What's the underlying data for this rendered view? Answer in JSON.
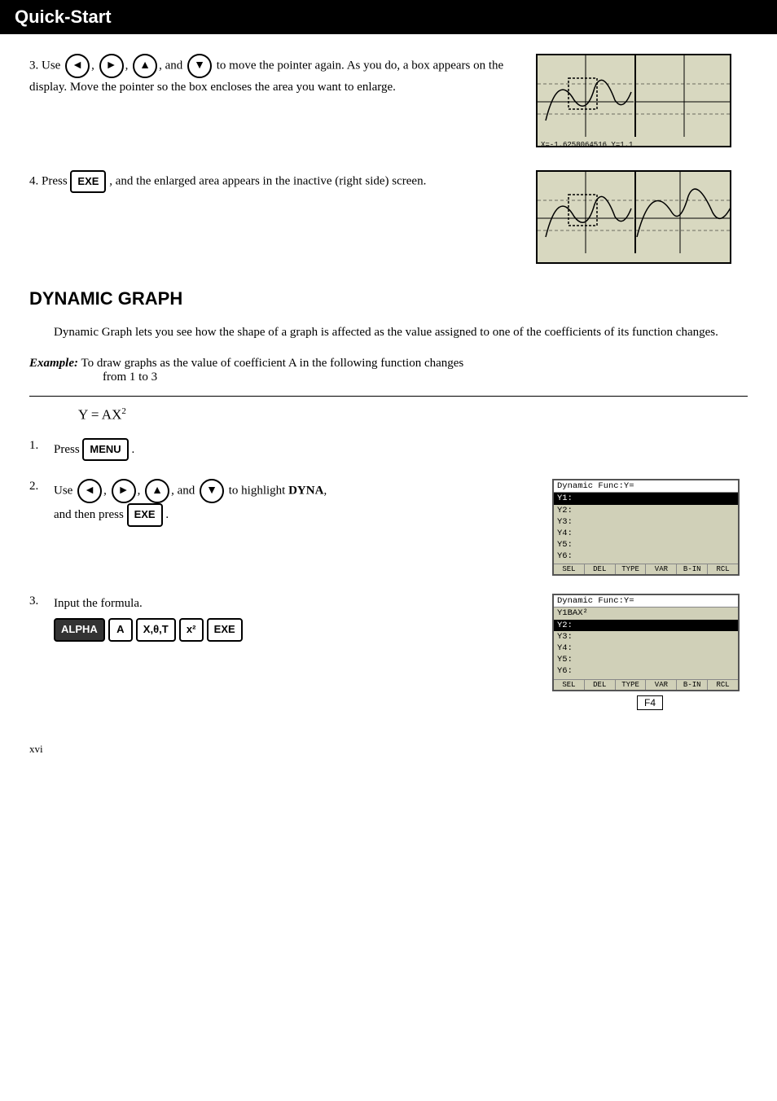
{
  "header": {
    "title": "Quick-Start"
  },
  "step3": {
    "number": "3.",
    "text1": "Use",
    "arrows": [
      "◄",
      "►",
      "▲",
      "▼"
    ],
    "and": "and",
    "text2": "to move the pointer again. As you do, a box appears on the display. Move the pointer so the box encloses the area you want to enlarge.",
    "screen_status": "X=-1.6258064516 Y=1.1"
  },
  "step4": {
    "number": "4.",
    "text1": "Press",
    "key": "EXE",
    "text2": ", and the enlarged area appears in the inactive (right side) screen."
  },
  "dynamic_graph": {
    "title": "DYNAMIC GRAPH",
    "intro": "Dynamic Graph lets you see how the shape of a graph is affected as the value assigned to one of the coefficients of its function changes.",
    "example_label": "Example:",
    "example_text": " To draw graphs as the value of coefficient A in the following  function changes",
    "example_indent": "from 1 to 3",
    "formula": "Y = AX²"
  },
  "dg_step1": {
    "number": "1.",
    "text1": "Press",
    "key": "MENU",
    "text2": "."
  },
  "dg_step2": {
    "number": "2.",
    "text1": "Use",
    "and": "and",
    "text2": "to highlight",
    "highlight": "DYNA",
    "text3": ",",
    "text4": "and then press",
    "key2": "EXE",
    "text5": ".",
    "screen": {
      "title": "Dynamic Func:Y=",
      "rows": [
        "Y1:",
        "Y2:",
        "Y3:",
        "Y4:",
        "Y5:",
        "Y6:"
      ],
      "selected_row": 0,
      "menu_items": [
        "SEL",
        "DEL",
        "TYPE",
        "VAR",
        "B-IN",
        "RCL"
      ]
    }
  },
  "dg_step3": {
    "number": "3.",
    "text": "Input the formula.",
    "keys": [
      "ALPHA",
      "A",
      "X,θ,T",
      "x²",
      "EXE"
    ],
    "screen": {
      "title": "Dynamic Func:Y=",
      "rows_before_selected": [
        "Y1BAX²"
      ],
      "selected_row": "Y2:",
      "rows_after_selected": [
        "Y3:",
        "Y4:",
        "Y5:",
        "Y6:"
      ],
      "menu_items": [
        "SEL",
        "DEL",
        "TYPE",
        "VAR",
        "B-IN",
        "RCL"
      ]
    },
    "f4_label": "F4"
  },
  "footer": {
    "page": "xvi"
  }
}
